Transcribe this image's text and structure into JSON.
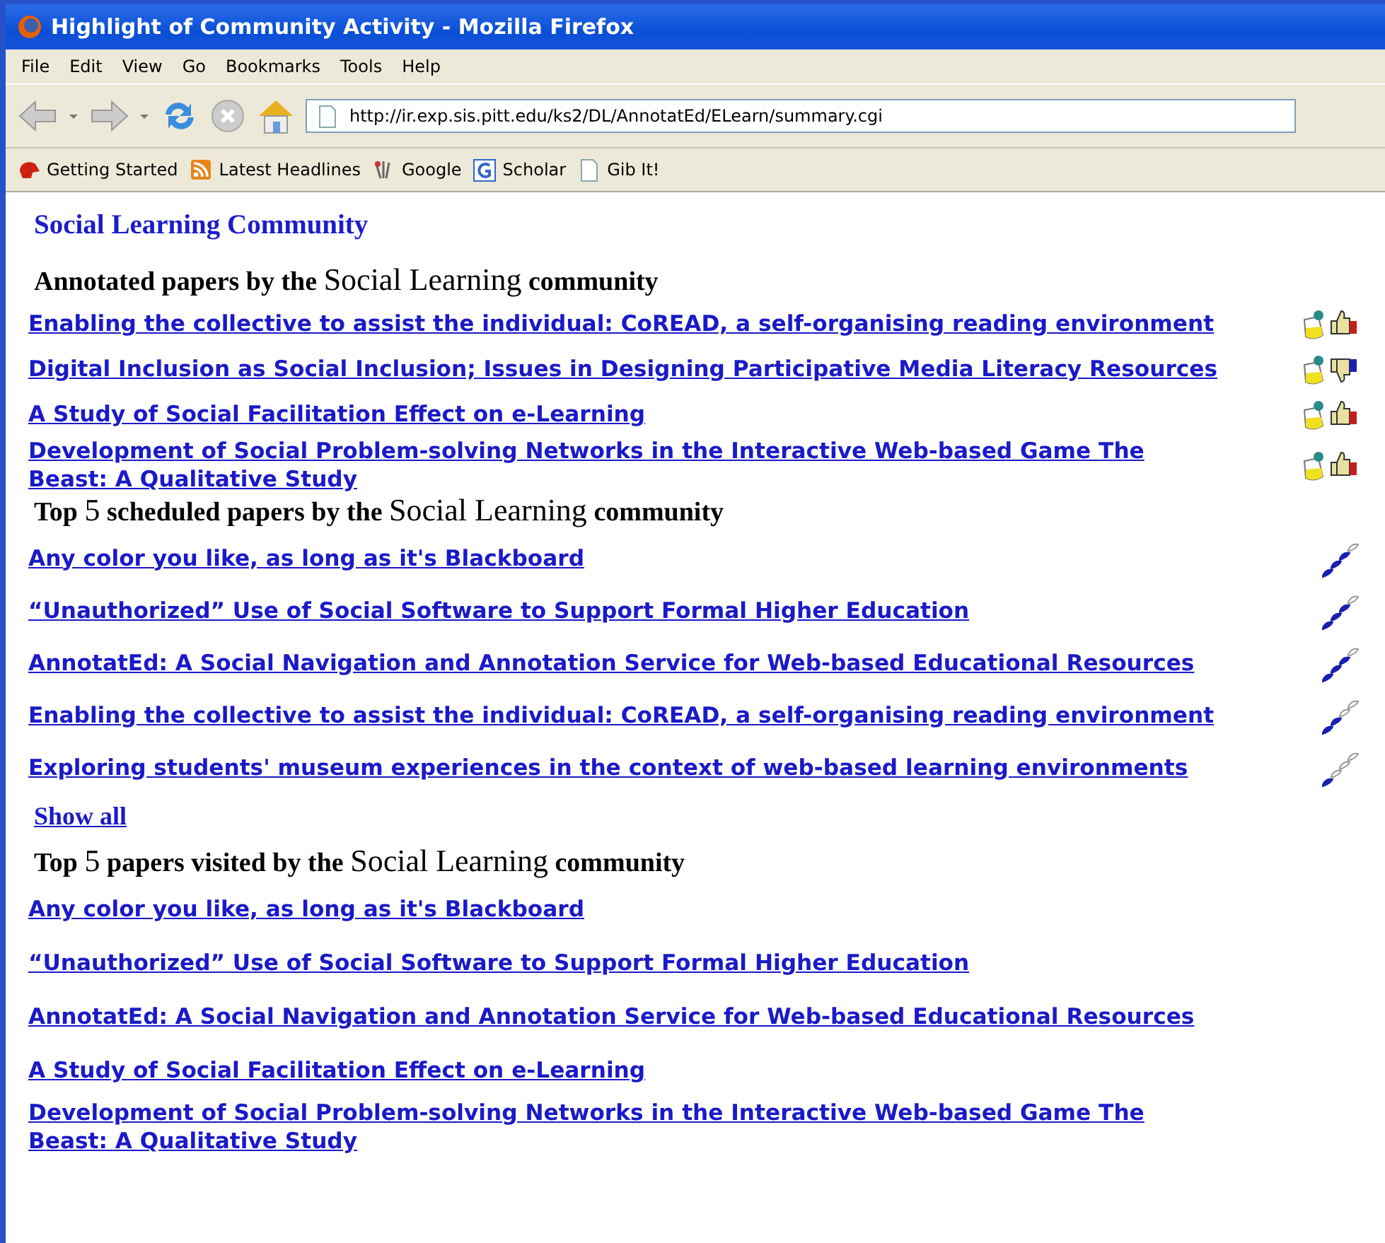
{
  "window": {
    "title": "Highlight of Community Activity - Mozilla Firefox"
  },
  "menu": [
    "File",
    "Edit",
    "View",
    "Go",
    "Bookmarks",
    "Tools",
    "Help"
  ],
  "address": {
    "value": "http://ir.exp.sis.pitt.edu/ks2/DL/AnnotatEd/ELearn/summary.cgi"
  },
  "bookmarks": [
    {
      "label": "Getting Started",
      "kind": "start"
    },
    {
      "label": "Latest Headlines",
      "kind": "feed"
    },
    {
      "label": "Google",
      "kind": "google"
    },
    {
      "label": "Scholar",
      "kind": "scholar"
    },
    {
      "label": "Gib It!",
      "kind": "page"
    }
  ],
  "page_title": "Social Learning Community",
  "sections": [
    {
      "heading": [
        {
          "text": "Annotated papers by the",
          "kind": "bold"
        },
        {
          "text": "Social Learning",
          "kind": "big"
        },
        {
          "text": "community",
          "kind": "bold"
        }
      ],
      "kind": "annotated",
      "items": [
        {
          "title": "Enabling the collective to assist the individual: CoREAD, a self-organising reading environment",
          "liked": true
        },
        {
          "title": "Digital Inclusion as Social Inclusion; Issues in Designing Participative Media Literacy Resources",
          "liked": false
        },
        {
          "title": "A Study of Social Facilitation Effect on e-Learning",
          "liked": true
        },
        {
          "title": "Development of Social Problem-solving Networks in the Interactive Web-based Game The Beast: A Qualitative Study",
          "liked": true
        }
      ]
    },
    {
      "heading": [
        {
          "text": "Top",
          "kind": "bold"
        },
        {
          "text": "5",
          "kind": "big"
        },
        {
          "text": "scheduled papers by the",
          "kind": "bold"
        },
        {
          "text": "Social Learning",
          "kind": "big"
        },
        {
          "text": "community",
          "kind": "bold"
        }
      ],
      "kind": "scheduled",
      "items": [
        {
          "title": "Any color you like, as long as it's Blackboard",
          "level": 0.75
        },
        {
          "title": "“Unauthorized” Use of Social Software to Support Formal Higher Education",
          "level": 0.75
        },
        {
          "title": "AnnotatEd: A Social Navigation and Annotation Service for Web-based Educational Resources",
          "level": 0.75
        },
        {
          "title": "Enabling the collective to assist the individual: CoREAD, a self-organising reading environment",
          "level": 0.5
        },
        {
          "title": "Exploring students' museum experiences in the context of web-based learning environments",
          "level": 0.25
        }
      ],
      "show_all": "Show all"
    },
    {
      "heading": [
        {
          "text": "Top",
          "kind": "bold"
        },
        {
          "text": "5",
          "kind": "big"
        },
        {
          "text": "papers visited by the",
          "kind": "bold"
        },
        {
          "text": "Social Learning",
          "kind": "big"
        },
        {
          "text": "community",
          "kind": "bold"
        }
      ],
      "kind": "visited",
      "items": [
        {
          "title": "Any color you like, as long as it's Blackboard"
        },
        {
          "title": "“Unauthorized” Use of Social Software to Support Formal Higher Education"
        },
        {
          "title": "AnnotatEd: A Social Navigation and Annotation Service for Web-based Educational Resources"
        },
        {
          "title": "A Study of Social Facilitation Effect on e-Learning"
        },
        {
          "title": "Development of Social Problem-solving Networks in the Interactive Web-based Game The Beast: A Qualitative Study"
        }
      ]
    }
  ]
}
